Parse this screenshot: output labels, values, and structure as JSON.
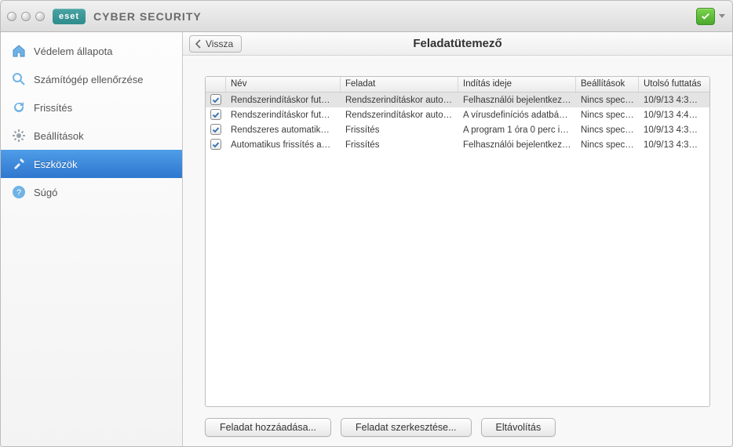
{
  "app": {
    "brand": "eset",
    "title": "CYBER SECURITY"
  },
  "sidebar": {
    "items": [
      {
        "id": "protection",
        "label": "Védelem állapota"
      },
      {
        "id": "scan",
        "label": "Számítógép ellenőrzése"
      },
      {
        "id": "update",
        "label": "Frissítés"
      },
      {
        "id": "settings",
        "label": "Beállítások"
      },
      {
        "id": "tools",
        "label": "Eszközök"
      },
      {
        "id": "help",
        "label": "Súgó"
      }
    ],
    "active_index": 4
  },
  "header": {
    "back_label": "Vissza",
    "page_title": "Feladatütemező"
  },
  "table": {
    "columns": {
      "name": "Név",
      "task": "Feladat",
      "start": "Indítás ideje",
      "settings": "Beállítások",
      "last": "Utolsó futtatás"
    },
    "rows": [
      {
        "checked": true,
        "selected": true,
        "name": "Rendszerindításkor fut…",
        "task": "Rendszerindításkor auto…",
        "start": "Felhasználói bejelentkez…",
        "settings": "Nincs speci…",
        "last": "10/9/13 4:3…"
      },
      {
        "checked": true,
        "selected": false,
        "name": "Rendszerindításkor fut…",
        "task": "Rendszerindításkor auto…",
        "start": "A vírusdefiníciós adatbá…",
        "settings": "Nincs speci…",
        "last": "10/9/13 4:4…"
      },
      {
        "checked": true,
        "selected": false,
        "name": "Rendszeres automatik…",
        "task": "Frissítés",
        "start": "A program 1 óra 0 perc i…",
        "settings": "Nincs speci…",
        "last": "10/9/13 4:3…"
      },
      {
        "checked": true,
        "selected": false,
        "name": "Automatikus frissítés a…",
        "task": "Frissítés",
        "start": "Felhasználói bejelentkez…",
        "settings": "Nincs speci…",
        "last": "10/9/13 4:3…"
      }
    ]
  },
  "footer": {
    "add": "Feladat hozzáadása...",
    "edit": "Feladat szerkesztése...",
    "remove": "Eltávolítás"
  },
  "colors": {
    "accent_blue": "#3c82d8",
    "accent_green": "#55b234"
  }
}
